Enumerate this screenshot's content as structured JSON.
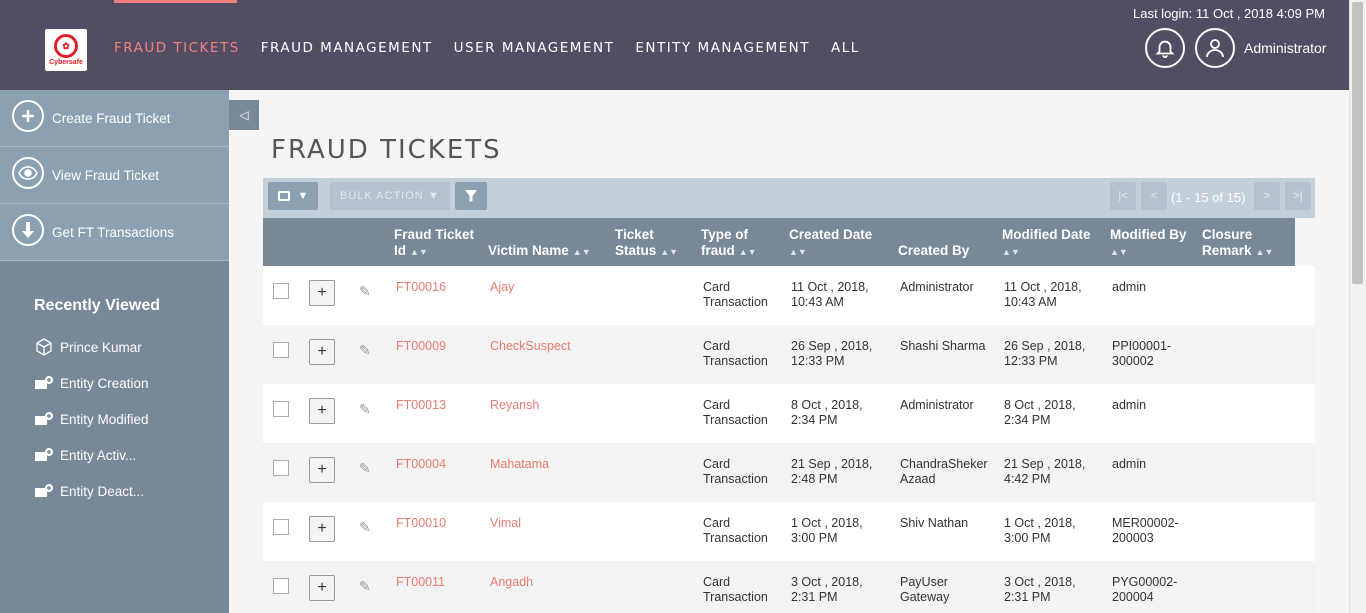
{
  "header": {
    "logo_text": "Cybersafe",
    "nav": [
      "FRAUD TICKETS",
      "FRAUD MANAGEMENT",
      "USER MANAGEMENT",
      "ENTITY MANAGEMENT",
      "ALL"
    ],
    "last_login": "Last login: 11 Oct , 2018 4:09 PM",
    "user": "Administrator"
  },
  "sidebar": {
    "actions": [
      "Create Fraud Ticket",
      "View Fraud Ticket",
      "Get FT Transactions"
    ],
    "recent_title": "Recently Viewed",
    "recent": [
      "Prince Kumar",
      "Entity Creation",
      "Entity Modified",
      "Entity Activ...",
      "Entity Deact..."
    ]
  },
  "main": {
    "title": "FRAUD TICKETS",
    "bulk_action": "BULK ACTION",
    "pager": "(1 - 15 of 15)",
    "columns": [
      {
        "l1": "Fraud Ticket",
        "l2": "Id"
      },
      {
        "l1": "",
        "l2": "Victim Name"
      },
      {
        "l1": "Ticket",
        "l2": "Status"
      },
      {
        "l1": "Type of",
        "l2": "fraud"
      },
      {
        "l1": "Created Date",
        "l2": ""
      },
      {
        "l1": "",
        "l2": "Created By"
      },
      {
        "l1": "Modified Date",
        "l2": ""
      },
      {
        "l1": "Modified By",
        "l2": ""
      },
      {
        "l1": "Closure",
        "l2": "Remark"
      }
    ],
    "rows": [
      {
        "id": "FT00016",
        "victim": "Ajay",
        "type1": "Card",
        "type2": "Transaction",
        "created1": "11 Oct , 2018,",
        "created2": "10:43 AM",
        "by1": "Administrator",
        "by2": "",
        "mod1": "11 Oct , 2018,",
        "mod2": "10:43 AM",
        "modby1": "admin",
        "modby2": ""
      },
      {
        "id": "FT00009",
        "victim": "CheckSuspect",
        "type1": "Card",
        "type2": "Transaction",
        "created1": "26 Sep , 2018,",
        "created2": "12:33 PM",
        "by1": "Shashi Sharma",
        "by2": "",
        "mod1": "26 Sep , 2018,",
        "mod2": "12:33 PM",
        "modby1": "PPI00001-",
        "modby2": "300002"
      },
      {
        "id": "FT00013",
        "victim": "Reyansh",
        "type1": "Card",
        "type2": "Transaction",
        "created1": "8 Oct , 2018,",
        "created2": "2:34 PM",
        "by1": "Administrator",
        "by2": "",
        "mod1": "8 Oct , 2018,",
        "mod2": "2:34 PM",
        "modby1": "admin",
        "modby2": ""
      },
      {
        "id": "FT00004",
        "victim": "Mahatama",
        "type1": "Card",
        "type2": "Transaction",
        "created1": "21 Sep , 2018,",
        "created2": "2:48 PM",
        "by1": "ChandraSheker",
        "by2": "Azaad",
        "mod1": "21 Sep , 2018,",
        "mod2": "4:42 PM",
        "modby1": "admin",
        "modby2": ""
      },
      {
        "id": "FT00010",
        "victim": "Vimal",
        "type1": "Card",
        "type2": "Transaction",
        "created1": "1 Oct , 2018,",
        "created2": "3:00 PM",
        "by1": "Shiv Nathan",
        "by2": "",
        "mod1": "1 Oct , 2018,",
        "mod2": "3:00 PM",
        "modby1": "MER00002-",
        "modby2": "200003"
      },
      {
        "id": "FT00011",
        "victim": "Angadh",
        "type1": "Card",
        "type2": "Transaction",
        "created1": "3 Oct , 2018,",
        "created2": "2:31 PM",
        "by1": "PayUser",
        "by2": "Gateway",
        "mod1": "3 Oct , 2018,",
        "mod2": "2:31 PM",
        "modby1": "PYG00002-",
        "modby2": "200004"
      }
    ]
  },
  "colors": {
    "topbar": "#534d64",
    "accent": "#f08080",
    "sidebar": "#788897",
    "link": "#e97b70"
  }
}
